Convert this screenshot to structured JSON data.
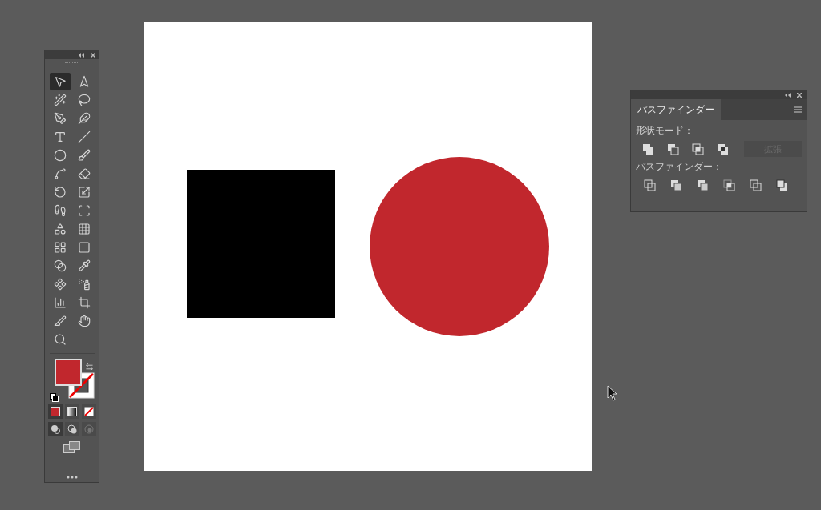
{
  "toolbar": {
    "tools": [
      {
        "kind": "selection",
        "selected": true
      },
      {
        "kind": "direct-selection",
        "selected": false
      },
      {
        "kind": "magic-wand",
        "selected": false
      },
      {
        "kind": "lasso",
        "selected": false
      },
      {
        "kind": "pen",
        "selected": false
      },
      {
        "kind": "curvature",
        "selected": false
      },
      {
        "kind": "type",
        "selected": false
      },
      {
        "kind": "line",
        "selected": false
      },
      {
        "kind": "ellipse",
        "selected": false
      },
      {
        "kind": "brush",
        "selected": false
      },
      {
        "kind": "shaper",
        "selected": false
      },
      {
        "kind": "eraser",
        "selected": false
      },
      {
        "kind": "rotate",
        "selected": false
      },
      {
        "kind": "scale",
        "selected": false
      },
      {
        "kind": "puppet",
        "selected": false
      },
      {
        "kind": "transform",
        "selected": false
      },
      {
        "kind": "shape-builder",
        "selected": false
      },
      {
        "kind": "perspective",
        "selected": false
      },
      {
        "kind": "mesh",
        "selected": false
      },
      {
        "kind": "gradient",
        "selected": false
      },
      {
        "kind": "blend",
        "selected": false
      },
      {
        "kind": "eyedropper",
        "selected": false
      },
      {
        "kind": "symbol",
        "selected": false
      },
      {
        "kind": "sprayer",
        "selected": false
      },
      {
        "kind": "graph",
        "selected": false
      },
      {
        "kind": "artboard",
        "selected": false
      },
      {
        "kind": "knife",
        "selected": false
      },
      {
        "kind": "hand",
        "selected": false
      },
      {
        "kind": "zoom",
        "selected": false
      }
    ],
    "color_modes": [
      {
        "kind": "color",
        "selected": true
      },
      {
        "kind": "gradient",
        "selected": false
      },
      {
        "kind": "none",
        "selected": false
      }
    ],
    "draw_modes": [
      {
        "kind": "normal",
        "selected": true
      },
      {
        "kind": "behind",
        "selected": false
      },
      {
        "kind": "inside",
        "selected": false
      }
    ]
  },
  "pathfinder": {
    "tab": "パスファインダー",
    "shape_modes_label": "形状モード：",
    "shape_modes": [
      {
        "kind": "unite"
      },
      {
        "kind": "minus-front"
      },
      {
        "kind": "intersect"
      },
      {
        "kind": "exclude"
      }
    ],
    "expand": {
      "label": "拡張",
      "disabled": true
    },
    "pathfinders_label": "パスファインダー：",
    "pathfinders": [
      {
        "kind": "divide"
      },
      {
        "kind": "trim"
      },
      {
        "kind": "merge"
      },
      {
        "kind": "crop"
      },
      {
        "kind": "outline"
      },
      {
        "kind": "minus-back"
      }
    ]
  }
}
